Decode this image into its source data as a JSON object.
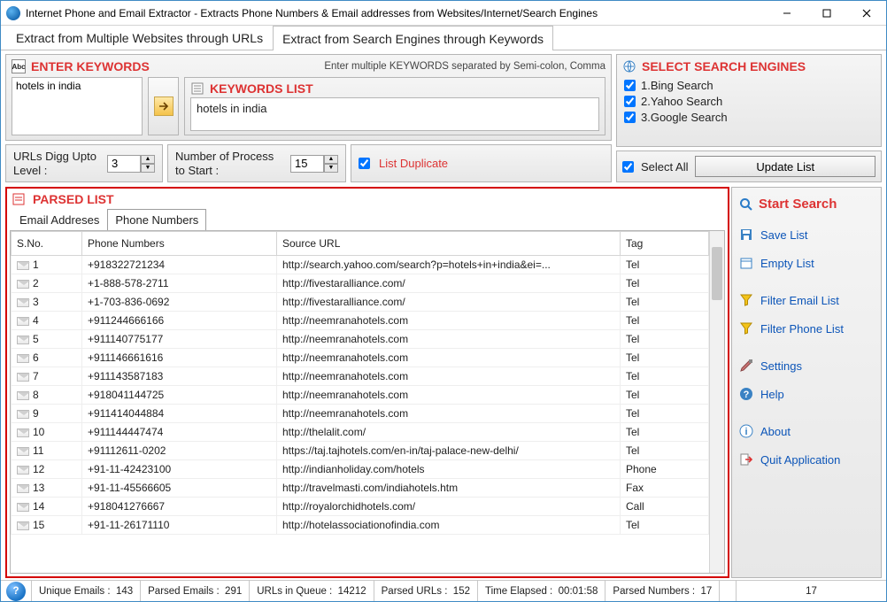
{
  "window": {
    "title": "Internet Phone and Email Extractor - Extracts Phone Numbers & Email addresses from Websites/Internet/Search Engines"
  },
  "top_tabs": {
    "urls": "Extract from Multiple Websites through URLs",
    "keywords": "Extract from Search Engines through Keywords",
    "active": "keywords"
  },
  "keywords": {
    "panel_title": "ENTER KEYWORDS",
    "hint": "Enter multiple KEYWORDS separated by Semi-colon, Comma",
    "input_value": "hotels in india",
    "list_title": "KEYWORDS LIST",
    "list_items": [
      "hotels in india"
    ]
  },
  "options": {
    "digg_label": "URLs Digg Upto Level :",
    "digg_value": "3",
    "proc_label": "Number of Process to Start :",
    "proc_value": "15",
    "list_dup_label": "List Duplicate",
    "list_dup_checked": true
  },
  "engines": {
    "panel_title": "SELECT SEARCH ENGINES",
    "items": [
      {
        "label": "1.Bing Search",
        "checked": true
      },
      {
        "label": "2.Yahoo Search",
        "checked": true
      },
      {
        "label": "3.Google Search",
        "checked": true
      }
    ],
    "select_all_label": "Select All",
    "select_all_checked": true,
    "update_btn": "Update List"
  },
  "parsed": {
    "panel_title": "PARSED LIST",
    "tabs": {
      "emails": "Email Addreses",
      "phones": "Phone Numbers",
      "active": "phones"
    },
    "columns": {
      "sno": "S.No.",
      "phone": "Phone Numbers",
      "url": "Source URL",
      "tag": "Tag"
    },
    "rows": [
      {
        "sno": "1",
        "phone": "+918322721234",
        "url": "http://search.yahoo.com/search?p=hotels+in+india&ei=...",
        "tag": "Tel"
      },
      {
        "sno": "2",
        "phone": "+1-888-578-2711",
        "url": "http://fivestaralliance.com/",
        "tag": "Tel"
      },
      {
        "sno": "3",
        "phone": "+1-703-836-0692",
        "url": "http://fivestaralliance.com/",
        "tag": "Tel"
      },
      {
        "sno": "4",
        "phone": "+911244666166",
        "url": "http://neemranahotels.com",
        "tag": "Tel"
      },
      {
        "sno": "5",
        "phone": "+911140775177",
        "url": "http://neemranahotels.com",
        "tag": "Tel"
      },
      {
        "sno": "6",
        "phone": "+911146661616",
        "url": "http://neemranahotels.com",
        "tag": "Tel"
      },
      {
        "sno": "7",
        "phone": "+911143587183",
        "url": "http://neemranahotels.com",
        "tag": "Tel"
      },
      {
        "sno": "8",
        "phone": "+918041144725",
        "url": "http://neemranahotels.com",
        "tag": "Tel"
      },
      {
        "sno": "9",
        "phone": "+911414044884",
        "url": "http://neemranahotels.com",
        "tag": "Tel"
      },
      {
        "sno": "10",
        "phone": "+911144447474",
        "url": "http://thelalit.com/",
        "tag": "Tel"
      },
      {
        "sno": "11",
        "phone": "+91112611-0202",
        "url": "https://taj.tajhotels.com/en-in/taj-palace-new-delhi/",
        "tag": "Tel"
      },
      {
        "sno": "12",
        "phone": "+91-11-42423100",
        "url": "http://indianholiday.com/hotels",
        "tag": "Phone"
      },
      {
        "sno": "13",
        "phone": "+91-11-45566605",
        "url": "http://travelmasti.com/indiahotels.htm",
        "tag": "Fax"
      },
      {
        "sno": "14",
        "phone": "+918041276667",
        "url": "http://royalorchidhotels.com/",
        "tag": "Call"
      },
      {
        "sno": "15",
        "phone": "+91-11-26171110",
        "url": "http://hotelassociationofindia.com",
        "tag": "Tel"
      }
    ]
  },
  "actions": {
    "start": "Start Search",
    "save": "Save List",
    "empty": "Empty List",
    "filter_email": "Filter Email List",
    "filter_phone": "Filter Phone List",
    "settings": "Settings",
    "help": "Help",
    "about": "About",
    "quit": "Quit Application"
  },
  "status": {
    "unique_emails_label": "Unique Emails :",
    "unique_emails": "143",
    "parsed_emails_label": "Parsed Emails :",
    "parsed_emails": "291",
    "urls_queue_label": "URLs in Queue :",
    "urls_queue": "14212",
    "parsed_urls_label": "Parsed URLs :",
    "parsed_urls": "152",
    "time_label": "Time Elapsed :",
    "time": "00:01:58",
    "parsed_numbers_label": "Parsed Numbers :",
    "parsed_numbers": "17",
    "right_count": "17"
  }
}
